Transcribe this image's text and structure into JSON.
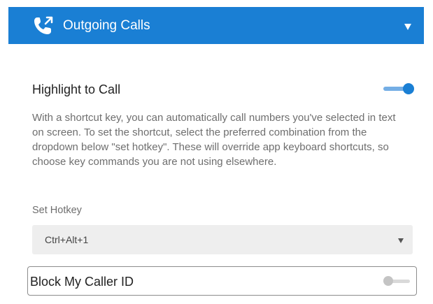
{
  "header": {
    "title": "Outgoing Calls",
    "icon": "phone-outgoing-icon",
    "expand_icon": "triangle-down-icon",
    "background_color": "#1a7fd4"
  },
  "highlight_to_call": {
    "title": "Highlight to Call",
    "enabled": true,
    "description": "With a shortcut key, you can automatically call numbers you've selected in text on screen. To set the shortcut, select the preferred combination from the dropdown below \"set hotkey\". These will override app keyboard shortcuts, so choose key commands you are not using elsewhere."
  },
  "hotkey": {
    "label": "Set Hotkey",
    "selected_value": "Ctrl+Alt+1"
  },
  "block_caller_id": {
    "label": "Block My Caller ID",
    "enabled": false
  }
}
